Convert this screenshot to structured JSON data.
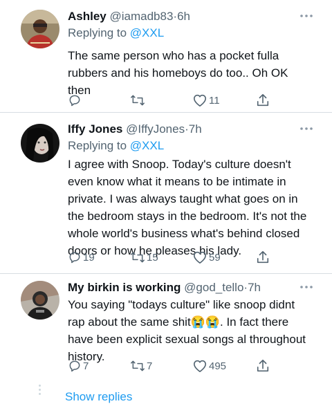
{
  "tweets": [
    {
      "name": "Ashley",
      "handle": "@iamadb83",
      "time": "6h",
      "replying_prefix": "Replying to",
      "replying_handle": "@XXL",
      "text": "The same person who has a pocket fulla rubbers and his homeboys do too.. Oh OK then",
      "replies": "",
      "retweets": "",
      "likes": "11"
    },
    {
      "name": "Iffy Jones",
      "handle": "@IffyJones",
      "time": "7h",
      "replying_prefix": "Replying to",
      "replying_handle": "@XXL",
      "text": "I agree with Snoop. Today's culture doesn't even know what it means to be intimate in private. I was always taught what goes on in the bedroom stays in the bedroom. It's not the whole world's business what's behind closed doors or how he pleases his lady.",
      "replies": "19",
      "retweets": "15",
      "likes": "59"
    },
    {
      "name": "My birkin is working",
      "handle": "@god_tello",
      "time": "7h",
      "text_before": "You saying \"todays culture\" like snoop didnt rap about the same shit",
      "emoji": "😭😭",
      "text_after": ". In fact there have been explicit sexual songs al throughout history.",
      "replies": "7",
      "retweets": "7",
      "likes": "495"
    }
  ],
  "separator": "·",
  "show_replies": "Show replies",
  "colors": {
    "accent": "#1d9bf0",
    "muted": "#536471",
    "text": "#0f1419",
    "divider": "#d7dde2"
  },
  "icons": [
    "more-icon",
    "reply-icon",
    "retweet-icon",
    "like-icon",
    "share-icon"
  ]
}
